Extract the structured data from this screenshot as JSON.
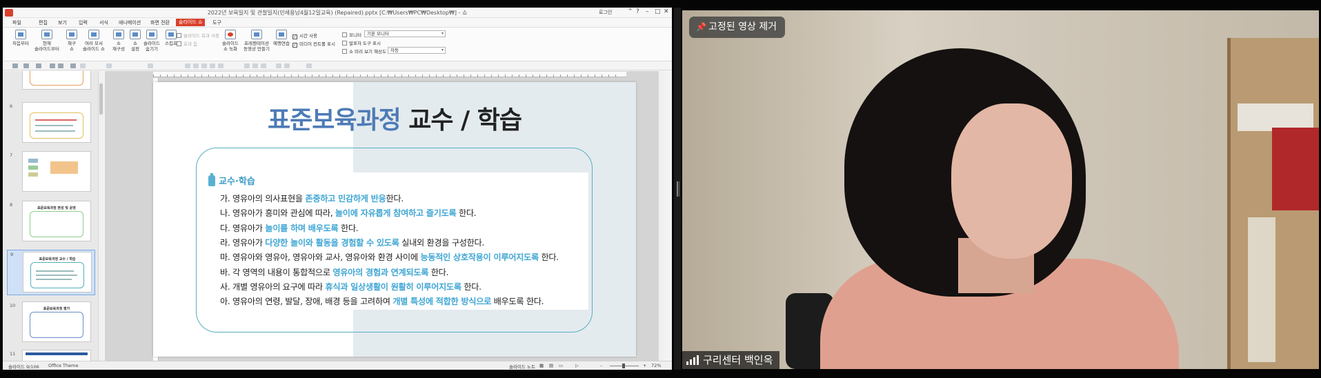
{
  "editor": {
    "window_title": "2022년 보육일지 및 관찰일지(민쇄용남4월12일교육) (Repaired).pptx [C:₩Users₩PC₩Desktop₩] - 쇼",
    "login_label": "로그인",
    "menus": [
      "파일",
      "편집",
      "보기",
      "입력",
      "서식",
      "애니메이션",
      "화면 전환",
      "슬라이드 쇼",
      "도구"
    ],
    "active_menu": "슬라이드 쇼",
    "ribbon": {
      "buttons": [
        "처음부터",
        "현재\n슬라이드부터",
        "재구\n쇼",
        "여러 모서\n슬라이드 쇼",
        "쇼\n재구성",
        "쇼\n설정",
        "슬라이드\n숨기기",
        "스킵프",
        "슬라이드\n쇼 녹화",
        "프레젠테이션\n동영상 만들기",
        "예행연습"
      ],
      "checks_a": [
        {
          "label": "슬라이드 효과 사용",
          "checked": false
        },
        {
          "label": "효과 음",
          "checked": false
        }
      ],
      "checks_b": [
        {
          "label": "시간 사용",
          "checked": true
        },
        {
          "label": "미디어 컨트롤 표시",
          "checked": true
        }
      ],
      "monitor_label": "모니터",
      "monitor_value": "기본 모니터",
      "presenter_label": "발표자 도구 표시",
      "resolution_label": "쇼 미리 보기 해상도",
      "resolution_value": "자동"
    },
    "thumbnails": [
      {
        "num": "6",
        "title": ""
      },
      {
        "num": "7",
        "title": ""
      },
      {
        "num": "8",
        "title": "표준보육과정 편성 및 운영"
      },
      {
        "num": "9",
        "title": "표준보육과정 교수 / 학습"
      },
      {
        "num": "10",
        "title": "표준보육과정 평가"
      },
      {
        "num": "11",
        "title": ""
      }
    ],
    "selected_thumbnail": "9",
    "slide": {
      "title_blue": "표준보육과정",
      "title_black": "교수 / 학습",
      "section_heading": "교수·학습",
      "bullets": [
        [
          {
            "t": "가. 영유아의 의사표현을 ",
            "h": false
          },
          {
            "t": "존중하고 민감하게 반응",
            "h": true
          },
          {
            "t": "한다.",
            "h": false
          }
        ],
        [
          {
            "t": "나. 영유아가 흥미와 관심에 따라, ",
            "h": false
          },
          {
            "t": "놀이에 자유롭게 참여하고 즐기도록",
            "h": true
          },
          {
            "t": " 한다.",
            "h": false
          }
        ],
        [
          {
            "t": "다. 영유아가 ",
            "h": false
          },
          {
            "t": "놀이를 하며 배우도록",
            "h": true
          },
          {
            "t": " 한다.",
            "h": false
          }
        ],
        [
          {
            "t": "라. 영유아가 ",
            "h": false
          },
          {
            "t": "다양한 놀이와 활동을 경험할 수 있도록",
            "h": true
          },
          {
            "t": " 실내외 환경을 구성한다.",
            "h": false
          }
        ],
        [
          {
            "t": "마. 영유아와 영유아, 영유아와 교사, 영유아와 환경 사이에 ",
            "h": false
          },
          {
            "t": "능동적인 상호작용이 이루어지도록",
            "h": true
          },
          {
            "t": " 한다.",
            "h": false
          }
        ],
        [
          {
            "t": "바. 각 영역의 내용이 통합적으로 ",
            "h": false
          },
          {
            "t": "영유아의 경험과 연계되도록",
            "h": true
          },
          {
            "t": " 한다.",
            "h": false
          }
        ],
        [
          {
            "t": "사. 개별 영유아의 요구에 따라 ",
            "h": false
          },
          {
            "t": "휴식과 일상생활이 원활히 이루어지도록",
            "h": true
          },
          {
            "t": " 한다.",
            "h": false
          }
        ],
        [
          {
            "t": "아. 영유아의 연령, 발달, 장애, 배경 등을 고려하여 ",
            "h": false
          },
          {
            "t": "개별 특성에 적합한 방식으로",
            "h": true
          },
          {
            "t": " 배우도록 한다.",
            "h": false
          }
        ]
      ]
    },
    "status": {
      "slide_counter": "슬라이드 9/106",
      "theme": "Office Theme",
      "note_label": "슬라이드 노트",
      "zoom": "72%"
    },
    "colors": {
      "accent": "#d9412b",
      "highlight": "#3fa6d4",
      "title_blue": "#4e7bb6"
    }
  },
  "video": {
    "pin_label": "고정된 영상 제거",
    "participant_name": "구리센터 백인옥",
    "icons": {
      "pin": "pin-icon",
      "signal": "signal-bars-icon"
    }
  }
}
